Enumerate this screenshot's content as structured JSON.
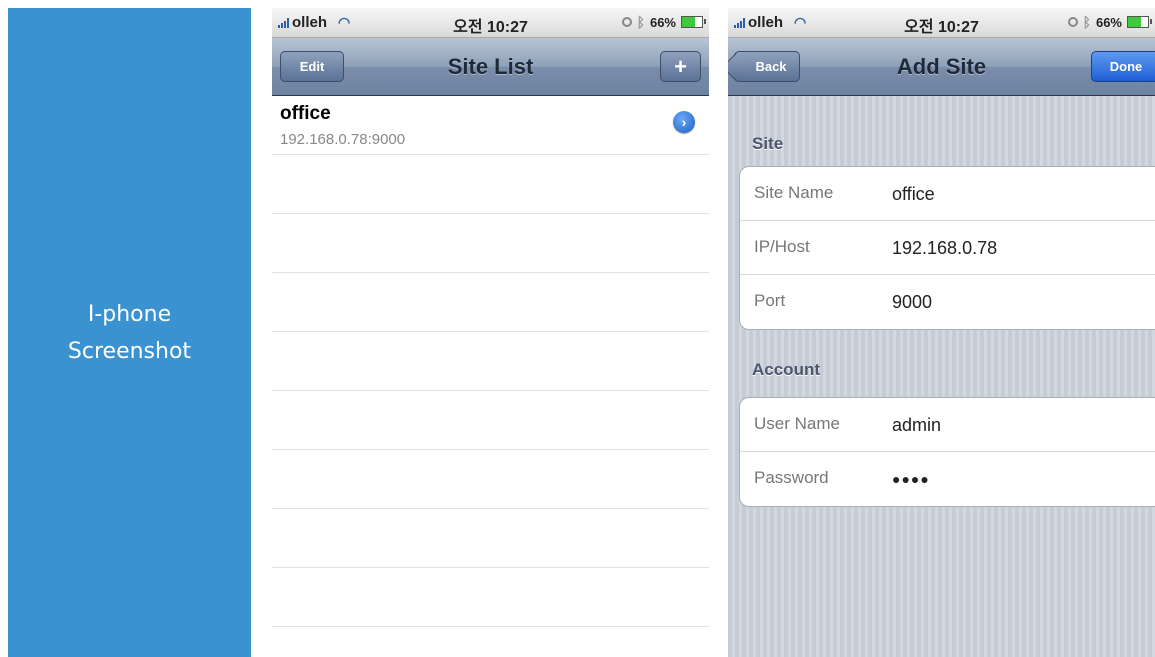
{
  "caption": {
    "line1": "I-phone",
    "line2": "Screenshot"
  },
  "status": {
    "carrier": "olleh",
    "time": "오전 10:27",
    "battery": "66%"
  },
  "site_list_screen": {
    "title": "Site List",
    "edit_label": "Edit",
    "add_label": "+",
    "items": [
      {
        "name": "office",
        "address": "192.168.0.78:9000"
      }
    ]
  },
  "add_site_screen": {
    "title": "Add Site",
    "back_label": "Back",
    "done_label": "Done",
    "site_section": "Site",
    "site_fields": [
      {
        "label": "Site Name",
        "value": "office"
      },
      {
        "label": "IP/Host",
        "value": "192.168.0.78"
      },
      {
        "label": "Port",
        "value": "9000"
      }
    ],
    "account_section": "Account",
    "account_fields": [
      {
        "label": "User Name",
        "value": "admin"
      },
      {
        "label": "Password",
        "value": "●●●●"
      }
    ]
  },
  "colors": {
    "caption_panel": "#3b92d0",
    "done_button": "#2f6fe0"
  }
}
